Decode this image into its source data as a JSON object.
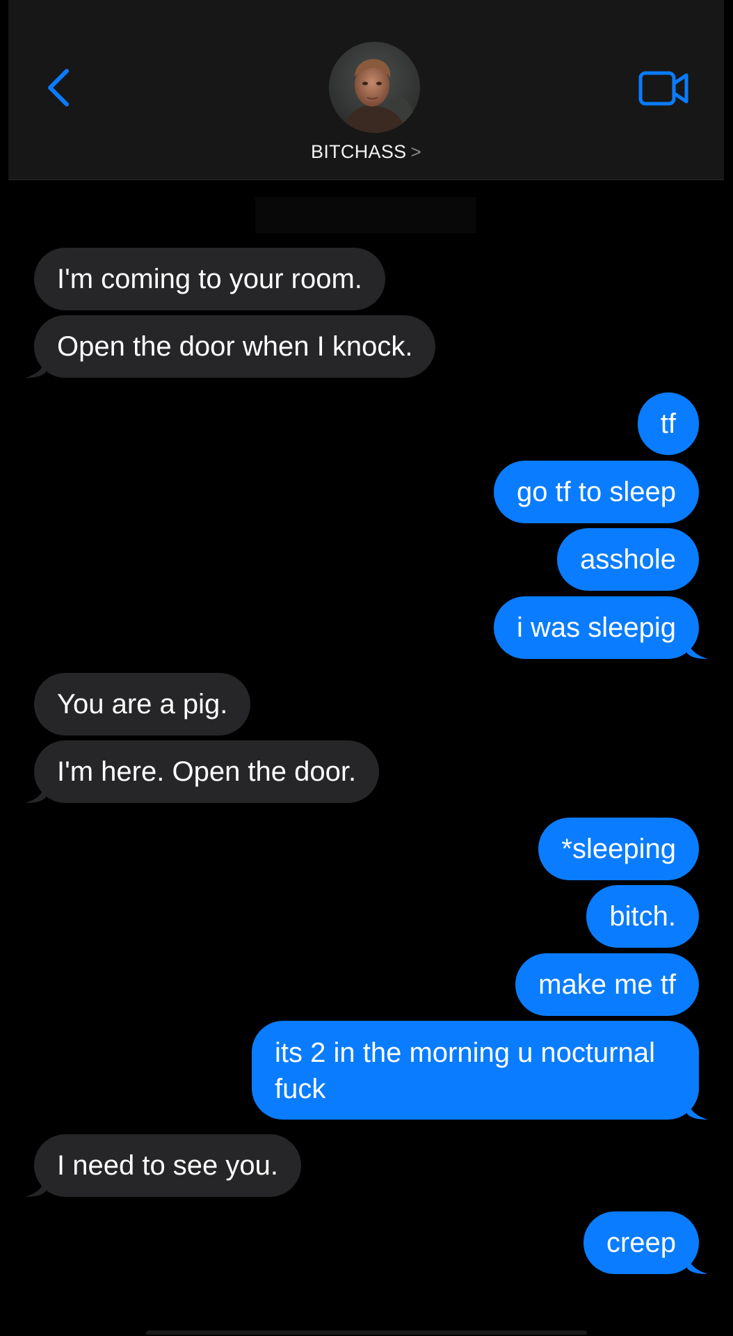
{
  "header": {
    "contact_name": "BITCHASS",
    "chevron": ">",
    "back_icon": "chevron-left-icon",
    "video_icon": "video-camera-icon",
    "accent_color": "#0a7cff"
  },
  "messages": [
    {
      "side": "in",
      "text": "I'm coming to your room."
    },
    {
      "side": "in",
      "text": "Open the door when I knock."
    },
    {
      "side": "out",
      "text": "tf"
    },
    {
      "side": "out",
      "text": "go tf to sleep"
    },
    {
      "side": "out",
      "text": "asshole"
    },
    {
      "side": "out",
      "text": "i was sleepig"
    },
    {
      "side": "in",
      "text": "You are a pig."
    },
    {
      "side": "in",
      "text": "I'm here. Open the door."
    },
    {
      "side": "out",
      "text": "*sleeping"
    },
    {
      "side": "out",
      "text": "bitch."
    },
    {
      "side": "out",
      "text": "make me tf"
    },
    {
      "side": "out",
      "text": "its 2 in the morning u nocturnal fuck"
    },
    {
      "side": "in",
      "text": "I need to see you."
    },
    {
      "side": "out",
      "text": "creep"
    }
  ]
}
